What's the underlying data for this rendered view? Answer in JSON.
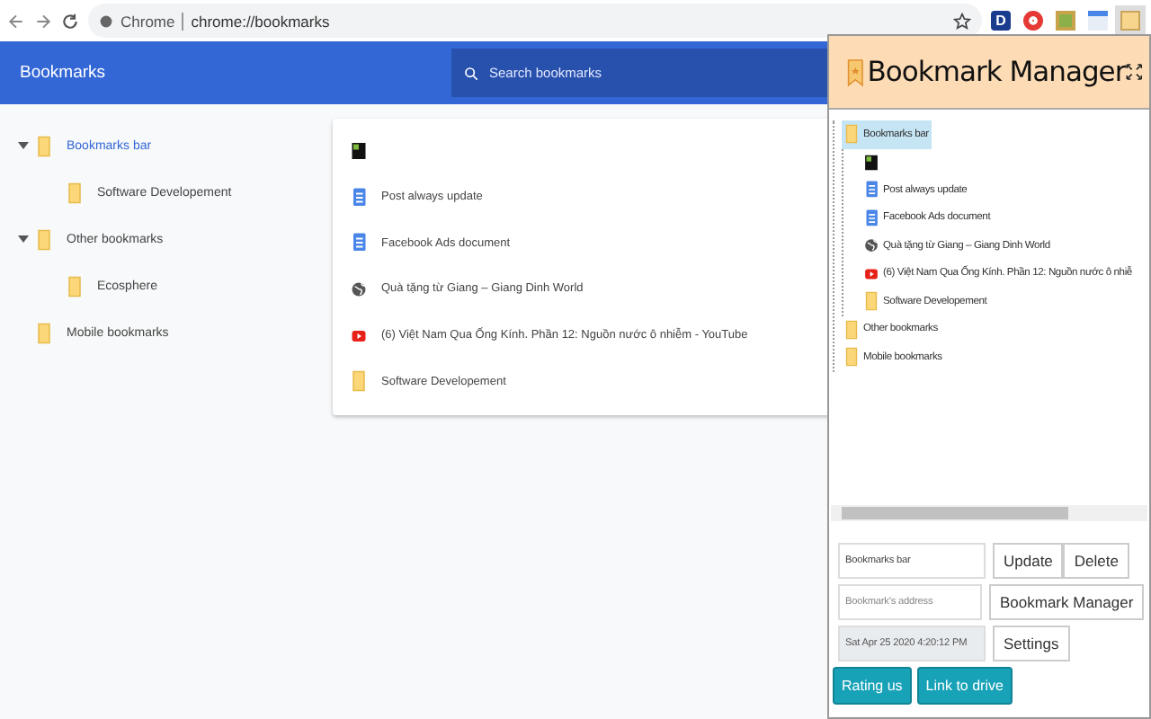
{
  "browser": {
    "site_label": "Chrome",
    "url": "chrome://bookmarks",
    "extensions": [
      {
        "kind": "letter",
        "label": "D"
      },
      {
        "kind": "record"
      },
      {
        "kind": "grid"
      },
      {
        "kind": "calendar"
      },
      {
        "kind": "bookmark",
        "selected": true
      }
    ]
  },
  "header": {
    "title": "Bookmarks",
    "search": {
      "placeholder": "Search bookmarks"
    }
  },
  "sidebar": {
    "items": [
      {
        "label": "Bookmarks bar",
        "selected": true,
        "expanded": true,
        "children": [
          {
            "label": "Software Developement",
            "selected": false
          }
        ]
      },
      {
        "label": "Other bookmarks",
        "selected": false,
        "expanded": true,
        "children": [
          {
            "label": "Ecosphere",
            "selected": false
          }
        ]
      },
      {
        "label": "Mobile bookmarks",
        "selected": false
      }
    ]
  },
  "list": {
    "items": [
      {
        "kind": "image"
      },
      {
        "kind": "doc",
        "title": "Post always update"
      },
      {
        "kind": "doc",
        "title": "Facebook Ads document"
      },
      {
        "kind": "globe",
        "title": "Quà tặng từ Giang – Giang Dinh World"
      },
      {
        "kind": "video",
        "title": "(6) Việt Nam Qua Ống Kính. Phần 12: Nguồn nước ô nhiễm - YouTube"
      },
      {
        "kind": "folder",
        "title": "Software Developement"
      }
    ]
  },
  "popup": {
    "title": "Bookmark Manager",
    "tree": [
      {
        "kind": "folder",
        "label": "Bookmarks bar",
        "selected": true,
        "children": [
          {
            "kind": "image",
            "selected": false
          },
          {
            "kind": "doc",
            "label": "Post always update",
            "selected": false
          },
          {
            "kind": "doc",
            "label": "Facebook Ads document",
            "selected": false
          },
          {
            "kind": "globe",
            "label": "Quà tặng từ Giang – Giang Dinh World",
            "selected": false
          },
          {
            "kind": "video",
            "label": "(6) Việt Nam Qua Ống Kính. Phần 12: Nguồn nước ô nhiễ",
            "selected": false
          },
          {
            "kind": "folder",
            "label": "Software Developement",
            "selected": false
          }
        ]
      },
      {
        "kind": "folder",
        "label": "Other bookmarks",
        "selected": false
      },
      {
        "kind": "folder",
        "label": "Mobile bookmarks",
        "selected": false
      }
    ],
    "form_rows": [
      {
        "field": {
          "value": "Bookmarks bar",
          "disabled": false
        },
        "buttons": [
          "Update",
          "Delete"
        ]
      },
      {
        "field": {
          "placeholder": "Bookmark's address",
          "disabled": false
        },
        "buttons": [
          "Bookmark Manager"
        ]
      },
      {
        "field": {
          "value": "Sat Apr 25 2020 4:20:12 PM",
          "disabled": true
        },
        "buttons": [
          "Settings"
        ]
      }
    ],
    "footer_buttons": [
      "Rating us",
      "Link to drive"
    ]
  }
}
